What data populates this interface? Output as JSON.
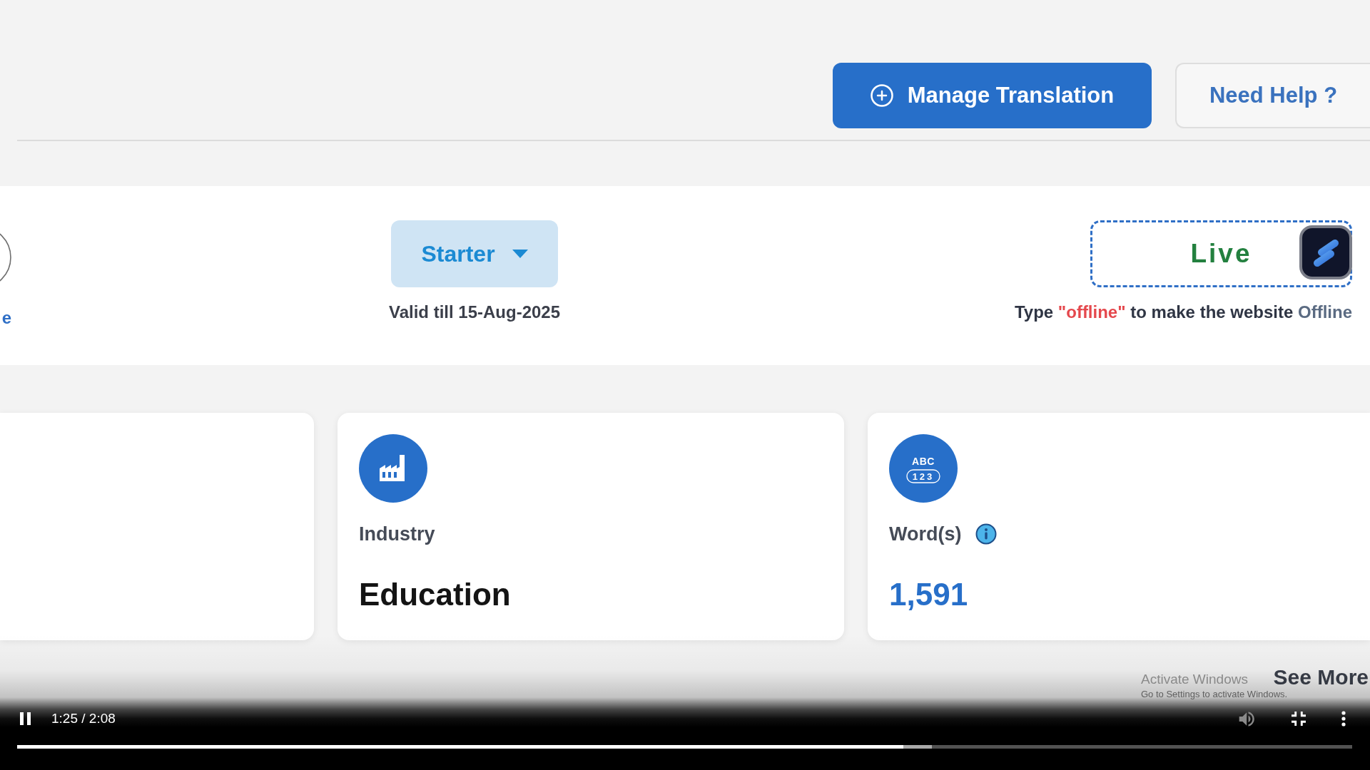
{
  "header": {
    "buttons": [
      {
        "kind": "primary",
        "label": "Manage Translation"
      },
      {
        "kind": "outline",
        "label": "Need Help ?"
      }
    ]
  },
  "plan_panel": {
    "cut_link": "e",
    "plan": {
      "label": "Starter",
      "validity": "Valid till 15-Aug-2025"
    },
    "status": {
      "value": "Live",
      "hint": [
        {
          "kind": "plain",
          "text": "Type "
        },
        {
          "kind": "keyword",
          "text": "\"offline\""
        },
        {
          "kind": "plain",
          "text": " to make the website "
        },
        {
          "kind": "state",
          "text": "Offline"
        }
      ]
    }
  },
  "cards": [
    {
      "kind": "blank"
    },
    {
      "kind": "industry",
      "label": "Industry",
      "value": "Education"
    },
    {
      "kind": "words",
      "label": "Word(s)",
      "icon_text": [
        "ABC",
        "123"
      ],
      "info": true,
      "value": "1,591"
    }
  ],
  "see_more": "See More",
  "activation_notice": {
    "title": "Activate Windows",
    "subtitle": "Go to Settings to activate Windows."
  },
  "video_controls": {
    "playing": true,
    "time": "1:25 / 2:08",
    "progress": {
      "buffered": {
        "level": 0.685
      },
      "played": {
        "level": 0.664
      }
    }
  }
}
